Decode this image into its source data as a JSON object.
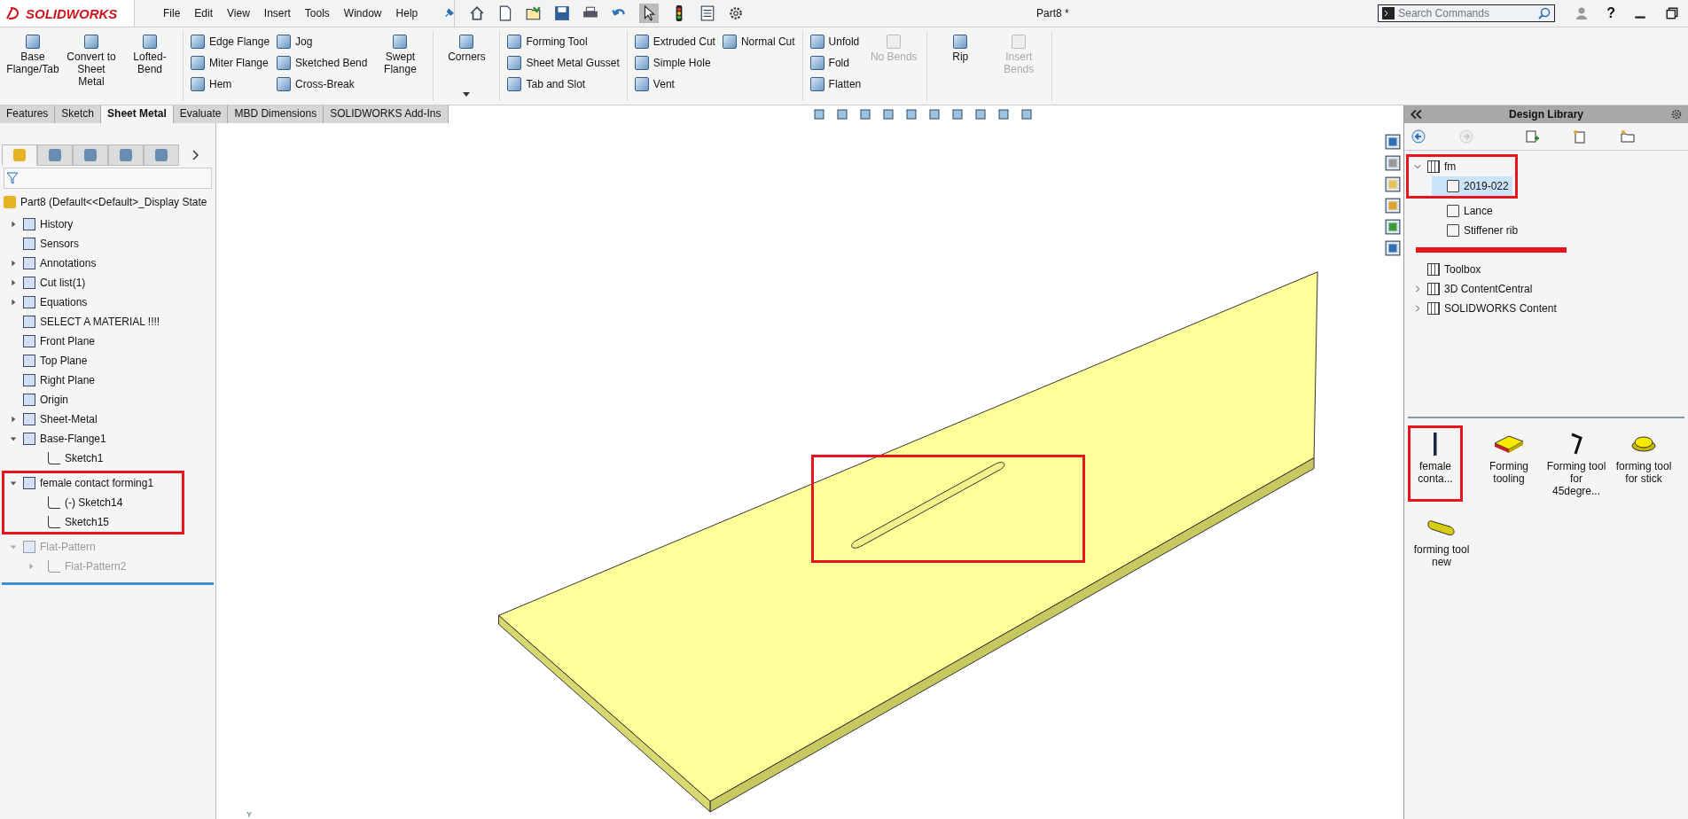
{
  "title_bar": {
    "logo": "SOLIDWORKS",
    "menu": [
      "File",
      "Edit",
      "View",
      "Insert",
      "Tools",
      "Window",
      "Help"
    ],
    "document_title": "Part8 *",
    "search": {
      "placeholder": "Search Commands"
    },
    "help_label": "?"
  },
  "ribbon": {
    "groups": [
      {
        "items": [
          {
            "label": "Base Flange/Tab",
            "kind": "large",
            "disabled": false
          },
          {
            "label": "Convert to Sheet Metal",
            "kind": "large",
            "disabled": false
          },
          {
            "label": "Lofted-Bend",
            "kind": "large",
            "disabled": false
          }
        ]
      },
      {
        "items": [
          {
            "label": "Edge Flange",
            "kind": "small",
            "disabled": false
          },
          {
            "label": "Miter Flange",
            "kind": "small",
            "disabled": false
          },
          {
            "label": "Hem",
            "kind": "small",
            "disabled": false
          },
          {
            "label": "Jog",
            "kind": "small",
            "disabled": false
          },
          {
            "label": "Sketched Bend",
            "kind": "small",
            "disabled": false
          },
          {
            "label": "Cross-Break",
            "kind": "small",
            "disabled": false
          },
          {
            "label": "Swept Flange",
            "kind": "large",
            "disabled": false
          }
        ]
      },
      {
        "items": [
          {
            "label": "Corners",
            "kind": "dropdown",
            "disabled": false
          }
        ]
      },
      {
        "items": [
          {
            "label": "Forming Tool",
            "kind": "small",
            "disabled": false
          },
          {
            "label": "Sheet Metal Gusset",
            "kind": "small",
            "disabled": false
          },
          {
            "label": "Tab and Slot",
            "kind": "small",
            "disabled": false
          }
        ]
      },
      {
        "items": [
          {
            "label": "Extruded Cut",
            "kind": "small",
            "disabled": false
          },
          {
            "label": "Simple Hole",
            "kind": "small",
            "disabled": false
          },
          {
            "label": "Vent",
            "kind": "small",
            "disabled": false
          },
          {
            "label": "Normal Cut",
            "kind": "small",
            "disabled": false
          }
        ]
      },
      {
        "items": [
          {
            "label": "Unfold",
            "kind": "small",
            "disabled": false
          },
          {
            "label": "Fold",
            "kind": "small",
            "disabled": false
          },
          {
            "label": "Flatten",
            "kind": "small",
            "disabled": false
          },
          {
            "label": "No Bends",
            "kind": "large",
            "disabled": true
          }
        ]
      },
      {
        "items": [
          {
            "label": "Rip",
            "kind": "large",
            "disabled": false
          },
          {
            "label": "Insert Bends",
            "kind": "large",
            "disabled": true
          }
        ]
      }
    ]
  },
  "tabs": [
    {
      "label": "Features",
      "selected": false
    },
    {
      "label": "Sketch",
      "selected": false
    },
    {
      "label": "Sheet Metal",
      "selected": true
    },
    {
      "label": "Evaluate",
      "selected": false
    },
    {
      "label": "MBD Dimensions",
      "selected": false
    },
    {
      "label": "SOLIDWORKS Add-Ins",
      "selected": false
    }
  ],
  "feature_manager": {
    "panel_tabs": [
      {
        "selected": true
      },
      {
        "selected": false
      },
      {
        "selected": false
      },
      {
        "selected": false
      },
      {
        "selected": false
      }
    ],
    "root": "Part8  (Default<<Default>_Display State",
    "items": [
      {
        "label": "History",
        "expandable": true,
        "expanded": false,
        "disabled": false
      },
      {
        "label": "Sensors",
        "expandable": false,
        "disabled": false
      },
      {
        "label": "Annotations",
        "expandable": true,
        "expanded": false,
        "disabled": false
      },
      {
        "label": "Cut list(1)",
        "expandable": true,
        "expanded": false,
        "disabled": false
      },
      {
        "label": "Equations",
        "expandable": true,
        "expanded": false,
        "disabled": false
      },
      {
        "label": "SELECT A MATERIAL !!!!",
        "expandable": false,
        "disabled": false
      },
      {
        "label": "Front Plane",
        "expandable": false,
        "disabled": false
      },
      {
        "label": "Top Plane",
        "expandable": false,
        "disabled": false
      },
      {
        "label": "Right Plane",
        "expandable": false,
        "disabled": false
      },
      {
        "label": "Origin",
        "expandable": false,
        "disabled": false
      },
      {
        "label": "Sheet-Metal",
        "expandable": true,
        "expanded": false,
        "disabled": false
      },
      {
        "label": "Base-Flange1",
        "expandable": true,
        "expanded": true,
        "disabled": false,
        "children": [
          {
            "label": "Sketch1",
            "expandable": false,
            "disabled": false
          }
        ]
      },
      {
        "label": "female contact forming1",
        "expandable": true,
        "expanded": true,
        "disabled": false,
        "highlighted": true,
        "children": [
          {
            "label": "(-) Sketch14",
            "expandable": false,
            "disabled": false,
            "highlighted": true
          },
          {
            "label": "Sketch15",
            "expandable": false,
            "disabled": false,
            "highlighted": true
          }
        ]
      },
      {
        "label": "Flat-Pattern",
        "expandable": true,
        "expanded": true,
        "disabled": true,
        "children": [
          {
            "label": "Flat-Pattern2",
            "expandable": true,
            "expanded": false,
            "disabled": true
          }
        ]
      }
    ]
  },
  "viewport": {
    "slot_highlighted": true,
    "axis_label": "Y"
  },
  "design_library": {
    "title": "Design Library",
    "tree": [
      {
        "label": "fm",
        "expandable": true,
        "expanded": true,
        "selected": false,
        "highlighted": true,
        "children": [
          {
            "label": "2019-022",
            "expandable": false,
            "selected": true,
            "highlighted": true
          },
          {
            "label": "Lance",
            "expandable": false,
            "selected": false
          },
          {
            "label": "Stiffener rib",
            "expandable": false,
            "selected": false
          }
        ]
      },
      {
        "selected": false,
        "redacted": true
      },
      {
        "label": "Toolbox",
        "expandable": false,
        "selected": false
      },
      {
        "label": "3D ContentCentral",
        "expandable": true,
        "expanded": false,
        "selected": false
      },
      {
        "label": "SOLIDWORKS Content",
        "expandable": true,
        "expanded": false,
        "selected": false
      }
    ],
    "items": [
      {
        "label": "female conta...",
        "kind": "bar",
        "highlighted": true
      },
      {
        "label": "Forming tooling",
        "kind": "block",
        "highlighted": false
      },
      {
        "label": "Forming tool for 45degre...",
        "kind": "bent",
        "highlighted": false
      },
      {
        "label": "forming tool for stick",
        "kind": "dome",
        "highlighted": false
      },
      {
        "label": "forming tool new",
        "kind": "pill",
        "highlighted": false
      }
    ]
  }
}
